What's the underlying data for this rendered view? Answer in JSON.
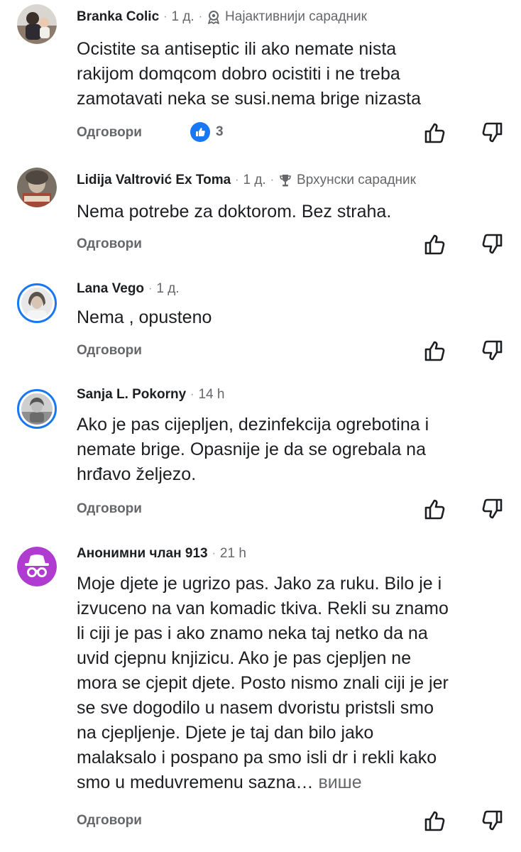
{
  "comments": [
    {
      "author": "Branka Colic",
      "time": "1 д.",
      "badge": "Најактивнији сарадник",
      "badge_icon": "top-contributor-icon",
      "text": "Ocistite sa antiseptic ili ako nemate nista\nrakijom domqcom dobro ocistiti i ne treba\nzamotavati neka se susi.nema brige nizasta",
      "reply": "Одговори",
      "likes": "3"
    },
    {
      "author": "Lidija Valtrović Ex Toma",
      "time": "1 д.",
      "badge": "Врхунски сарадник",
      "badge_icon": "trophy-icon",
      "text": "Nema potrebe za doktorom. Bez straha.",
      "reply": "Одговори"
    },
    {
      "author": "Lana Vego",
      "time": "1 д.",
      "text": "Nema , opusteno",
      "reply": "Одговори"
    },
    {
      "author": "Sanja L. Pokorny",
      "time": "14 h",
      "text": "Ako je pas cijepljen, dezinfekcija ogrebotina i\nnemate brige. Opasnije je da se ogrebala na\nhrđavo željezo.",
      "reply": "Одговори"
    },
    {
      "author": "Анонимни члан 913",
      "time": "21 h",
      "text": "Moje djete je ugrizo pas. Jako za ruku. Bilo je i\nizvuceno na van komadic tkiva. Rekli su znamo\nli ciji je pas i ako znamo neka taj netko da na\nuvid cjepnu knjizicu. Ako je pas cjepljen ne\nmora se cjepit djete. Posto nismo znali ciji je jer\nse sve dogodilo u nasem dvoristu pristsli smo\nna cjepljenje. Djete je taj dan bilo jako\nmalaksalo i pospano pa smo isli dr i rekli kako\nsmo u meduvremenu sazna…",
      "more": "више",
      "reply": "Одговори"
    }
  ],
  "colors": {
    "accent": "#1877f2",
    "secondary_text": "#65676b",
    "anon_avatar": "#b03bd1"
  }
}
